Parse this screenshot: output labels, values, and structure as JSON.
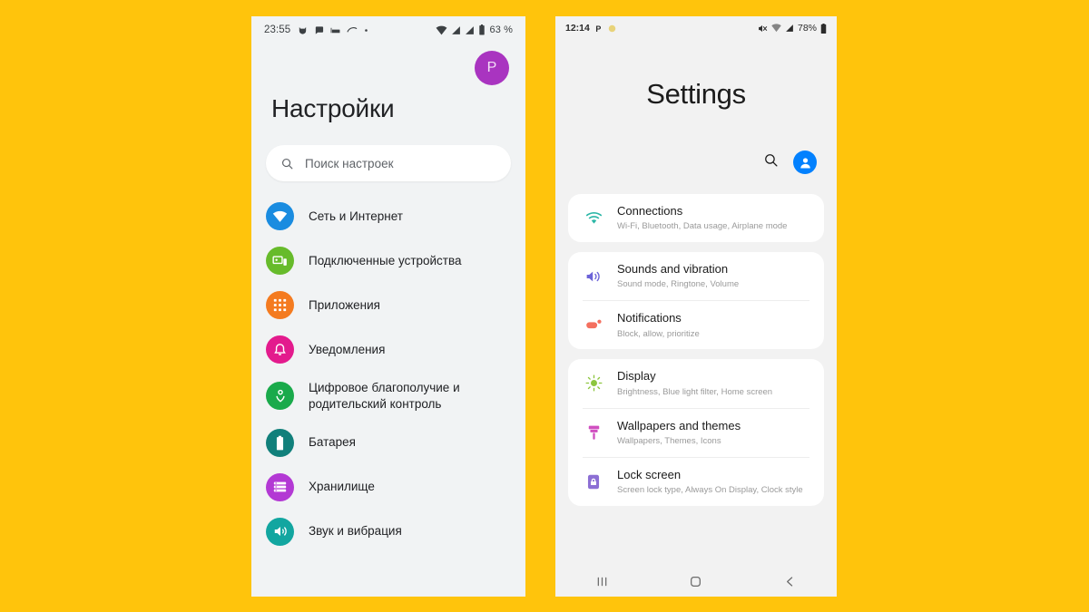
{
  "background_color": "#FFC40C",
  "left_phone": {
    "name": "stock-android-settings",
    "status_bar": {
      "time": "23:55",
      "battery_text": "63 %",
      "left_icons": [
        "cat-icon",
        "chat-bubble-icon",
        "bed-icon",
        "swipe-icon",
        "dot-icon"
      ],
      "right_icons": [
        "wifi-icon",
        "signal-icon",
        "signal-icon",
        "battery-icon"
      ]
    },
    "avatar_letter": "P",
    "avatar_color": "#a934c0",
    "title": "Настройки",
    "search": {
      "placeholder": "Поиск настроек"
    },
    "items": [
      {
        "label": "Сеть и Интернет",
        "icon": "wifi-icon",
        "color": "#1a8ce0"
      },
      {
        "label": "Подключенные устройства",
        "icon": "devices-icon",
        "color": "#67bb2b"
      },
      {
        "label": "Приложения",
        "icon": "apps-grid-icon",
        "color": "#f47b20"
      },
      {
        "label": "Уведомления",
        "icon": "bell-icon",
        "color": "#e31b8d"
      },
      {
        "label": "Цифровое благополучие и родительский контроль",
        "icon": "heart-shield-icon",
        "color": "#1aaa4b"
      },
      {
        "label": "Батарея",
        "icon": "battery-icon",
        "color": "#11807b"
      },
      {
        "label": "Хранилище",
        "icon": "storage-list-icon",
        "color": "#b339d4"
      },
      {
        "label": "Звук и вибрация",
        "icon": "sound-icon",
        "color": "#12a6a0"
      }
    ]
  },
  "right_phone": {
    "name": "samsung-one-ui-settings",
    "status_bar": {
      "time": "12:14",
      "battery_text": "78%",
      "left_icons": [
        "p-badge-icon",
        "yellow-dot-icon"
      ],
      "right_icons": [
        "mute-icon",
        "wifi-icon",
        "signal-icon",
        "battery-icon"
      ]
    },
    "title": "Settings",
    "actions": {
      "search": "search-icon",
      "profile": "account-icon"
    },
    "accent_color": "#0381fe",
    "groups": [
      {
        "rows": [
          {
            "title": "Connections",
            "subtitle": "Wi-Fi, Bluetooth, Data usage, Airplane mode",
            "icon": "wifi-icon",
            "color": "#2ab6a6"
          }
        ]
      },
      {
        "rows": [
          {
            "title": "Sounds and vibration",
            "subtitle": "Sound mode, Ringtone, Volume",
            "icon": "speaker-icon",
            "color": "#6c63d8"
          },
          {
            "title": "Notifications",
            "subtitle": "Block, allow, prioritize",
            "icon": "notification-icon",
            "color": "#f4705f"
          }
        ]
      },
      {
        "rows": [
          {
            "title": "Display",
            "subtitle": "Brightness, Blue light filter, Home screen",
            "icon": "brightness-icon",
            "color": "#8dc63f"
          },
          {
            "title": "Wallpapers and themes",
            "subtitle": "Wallpapers, Themes, Icons",
            "icon": "brush-icon",
            "color": "#d04fc0"
          },
          {
            "title": "Lock screen",
            "subtitle": "Screen lock type, Always On Display, Clock style",
            "icon": "lock-icon",
            "color": "#8c6fd4"
          }
        ]
      }
    ],
    "nav_bar": [
      {
        "label": "recents-icon"
      },
      {
        "label": "home-icon"
      },
      {
        "label": "back-icon"
      }
    ]
  }
}
